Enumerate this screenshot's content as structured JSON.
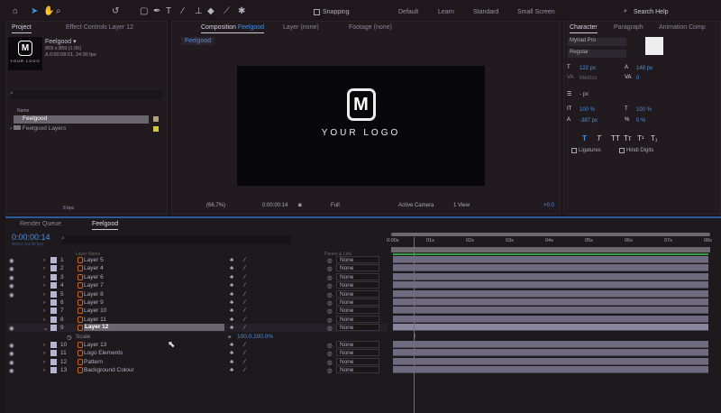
{
  "toolbar": {
    "snapping": "Snapping",
    "workspaces": [
      "Default",
      "Learn",
      "Standard",
      "Small Screen"
    ],
    "search": "Search Help"
  },
  "project": {
    "tab": "Project",
    "effect_tab": "Effect Controls Layer 12",
    "comp_name": "Feelgood ▾",
    "comp_size": "859 x 859 (1.00)",
    "comp_duration": "Δ 0:00:08:01, 24.00 fps",
    "thumb_text": "YOUR LOGO",
    "thumb_letter": "M",
    "col_name": "Name",
    "items": [
      "Feelgood",
      "Feelgood Layers"
    ],
    "bpc": "8 bpc"
  },
  "comp": {
    "tab_prefix": "Composition",
    "tab_name": "Feelgood",
    "layer_tab": "Layer (none)",
    "footage_tab": "Footage (none)",
    "subtab": "Feelgood",
    "logo_letter": "M",
    "logo_text": "YOUR LOGO",
    "zoom": "(66.7%)",
    "timecode": "0:00:00:14",
    "resolution": "Full",
    "camera": "Active Camera",
    "view": "1 View",
    "exposure": "+0.0"
  },
  "character": {
    "tab": "Character",
    "paragraph_tab": "Paragraph",
    "anim_tab": "Animation Comp",
    "font": "Myriad Pro",
    "style": "Regular",
    "size": "122 px",
    "leading": "148 px",
    "kerning": "Metrics",
    "tracking": "0",
    "stroke": "- px",
    "vscale": "100 %",
    "hscale": "100 %",
    "baseline": "-387 px",
    "tsume": "0 %",
    "styles": [
      "T",
      "T",
      "TT",
      "Tт",
      "T¹",
      "T₁"
    ],
    "ligatures": "Ligatures",
    "hindi": "Hindi Digits"
  },
  "timeline": {
    "render_tab": "Render Queue",
    "comp_tab": "Feelgood",
    "timecode": "0:00:00:14",
    "frame_info": "00014 (24.00 fps)",
    "col_layer": "Layer Name",
    "col_parent": "Parent & Link",
    "ruler": [
      "0:00s",
      "01s",
      "02s",
      "03s",
      "04s",
      "05s",
      "06s",
      "07s",
      "08s"
    ],
    "current_time_s": 0.583,
    "duration_s": 8,
    "layers": [
      {
        "n": "1",
        "name": "Layer 5",
        "eye": true
      },
      {
        "n": "2",
        "name": "Layer 4",
        "eye": true
      },
      {
        "n": "3",
        "name": "Layer 6",
        "eye": true
      },
      {
        "n": "4",
        "name": "Layer 7",
        "eye": true
      },
      {
        "n": "5",
        "name": "Layer 8",
        "eye": true
      },
      {
        "n": "6",
        "name": "Layer 9",
        "eye": false
      },
      {
        "n": "7",
        "name": "Layer 10",
        "eye": false
      },
      {
        "n": "8",
        "name": "Layer 11",
        "eye": false
      },
      {
        "n": "9",
        "name": "Layer 12",
        "eye": true,
        "selected": true
      },
      {
        "n": "10",
        "name": "Layer 13",
        "eye": true
      },
      {
        "n": "11",
        "name": "Logo Elements",
        "eye": true
      },
      {
        "n": "12",
        "name": "Pattern",
        "eye": true
      },
      {
        "n": "13",
        "name": "Background Colour",
        "eye": true
      }
    ],
    "parent_value": "None",
    "scale_label": "Scale",
    "scale_value": "100.0,100.0%"
  }
}
